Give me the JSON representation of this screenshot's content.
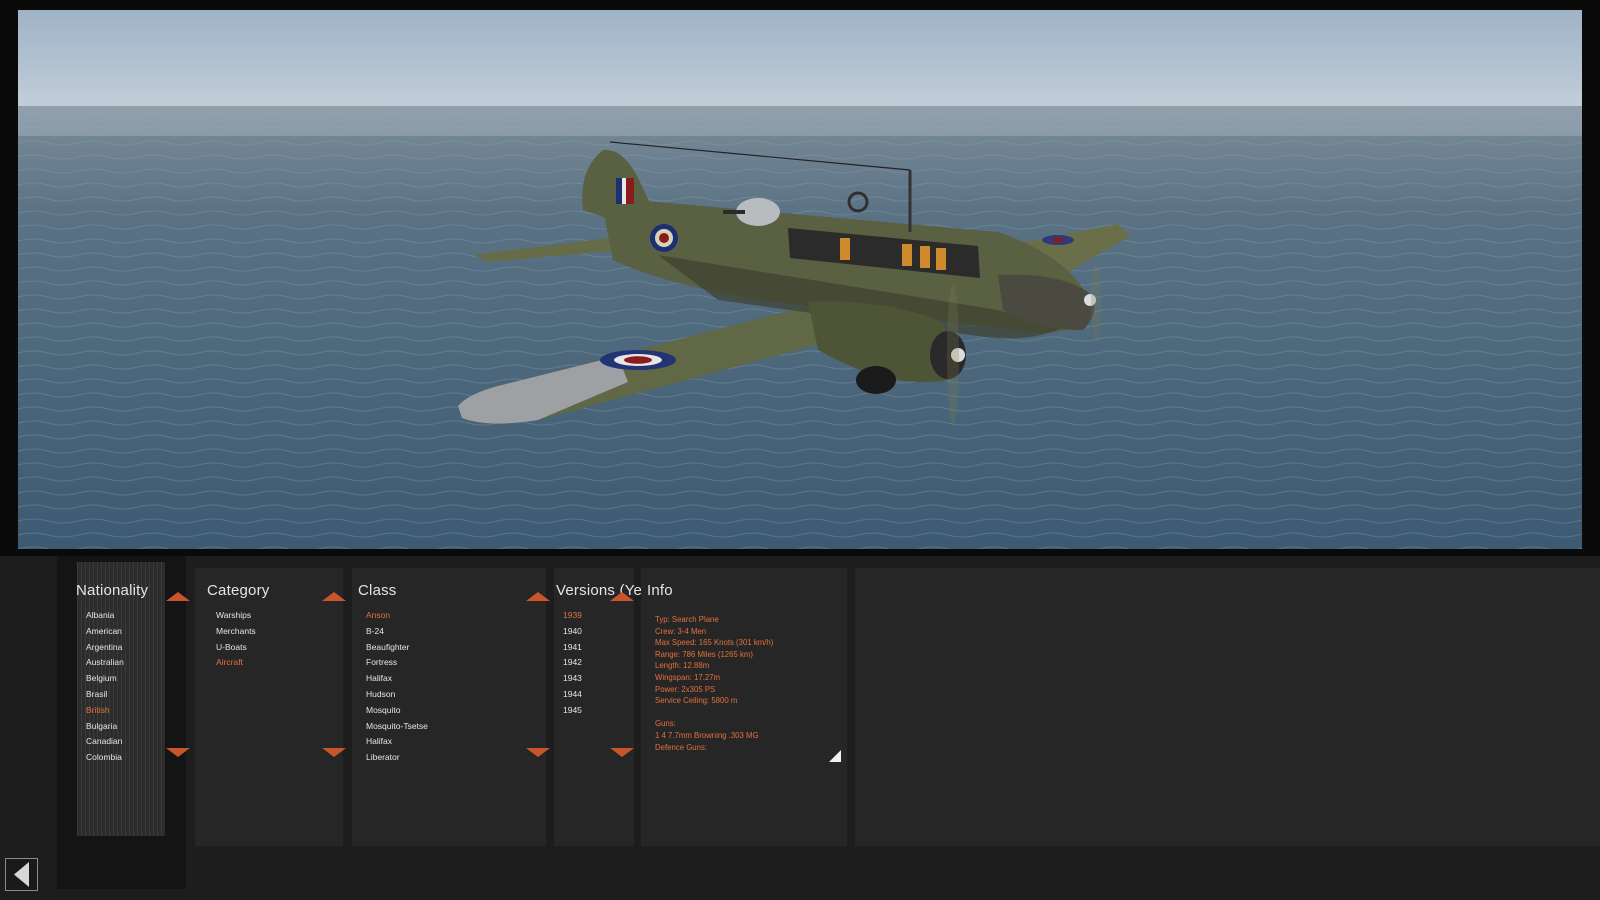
{
  "colors": {
    "accent": "#e3703e",
    "arrow": "#c8562a",
    "panel": "#262626",
    "background": "#1d1d1d",
    "text": "#e6e6e6"
  },
  "scene": {
    "subject": "aircraft-3d-view"
  },
  "nationality": {
    "title": "Nationality",
    "items": [
      "Albania",
      "American",
      "Argentina",
      "Australian",
      "Belgium",
      "Brasil",
      "British",
      "Bulgaria",
      "Canadian",
      "Colombia"
    ],
    "selected": "British"
  },
  "category": {
    "title": "Category",
    "items": [
      "Warships",
      "Merchants",
      "U-Boats",
      "Aircraft"
    ],
    "selected": "Aircraft"
  },
  "class": {
    "title": "Class",
    "items": [
      "Anson",
      "B-24",
      "Beaufighter",
      "Fortress",
      "Halifax",
      "Hudson",
      "Mosquito",
      "Mosquito-Tsetse",
      "Halifax",
      "Liberator"
    ],
    "selected": "Anson"
  },
  "versions": {
    "title": "Versions (Year)",
    "items": [
      "1939",
      "1940",
      "1941",
      "1942",
      "1943",
      "1944",
      "1945"
    ],
    "selected": "1939"
  },
  "info": {
    "title": "Info",
    "lines": [
      "Typ: Search Plane",
      "Crew: 3-4 Men",
      "Max Speed: 165 Knots (301 km/h)",
      "Range: 786 Miles (1265 km)",
      "Length: 12.88m",
      "Wingspan: 17.27m",
      "Power: 2x305 PS",
      "Service Ceiling: 5800 m",
      "",
      "Guns:",
      "1 4 7.7mm Browning .303 MG",
      "Defence Guns:"
    ]
  },
  "icons": {
    "back": "back-arrow-icon",
    "scroll_up": "scroll-up-arrow-icon",
    "scroll_down": "scroll-down-arrow-icon",
    "resize": "resize-corner-icon"
  }
}
